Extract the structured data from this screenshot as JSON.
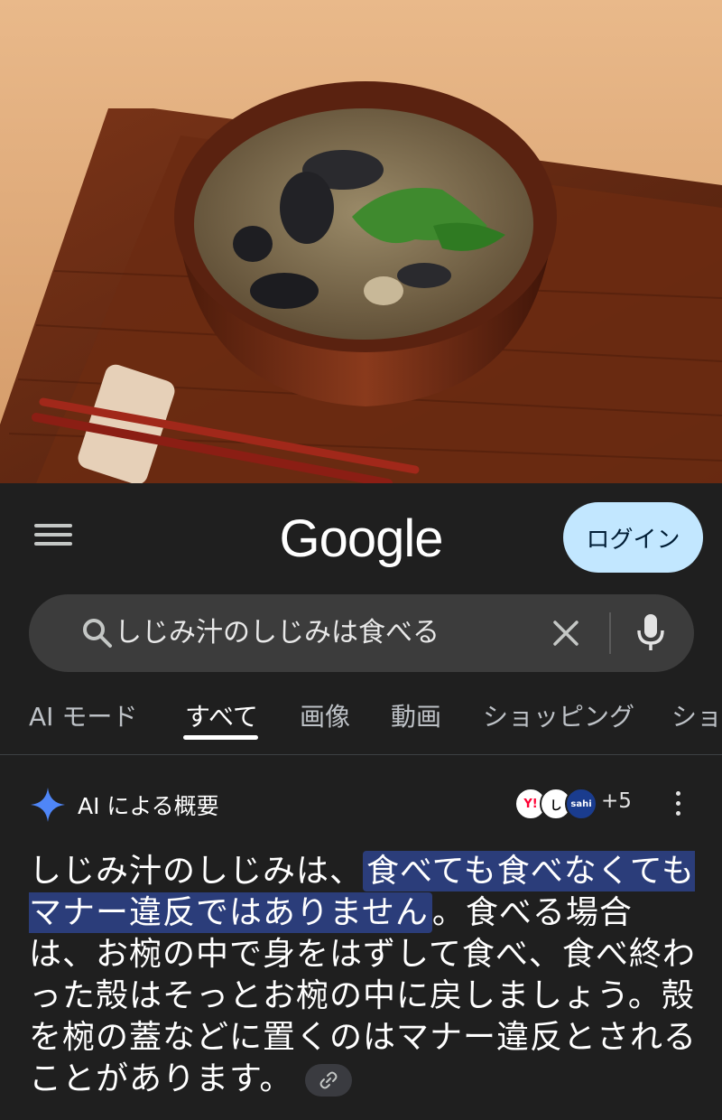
{
  "hero": {
    "image_description_icon": "miso-soup-photo"
  },
  "header": {
    "logo": "Google",
    "login_label": "ログイン"
  },
  "search": {
    "query": "しじみ汁のしじみは食べる"
  },
  "tabs": [
    {
      "label": "AI モード",
      "active": false
    },
    {
      "label": "すべて",
      "active": true
    },
    {
      "label": "画像",
      "active": false
    },
    {
      "label": "動画",
      "active": false
    },
    {
      "label": "ショッピング",
      "active": false
    },
    {
      "label": "ショ",
      "active": false
    }
  ],
  "ai_overview": {
    "title": "AI による概要",
    "sources": [
      "Y!",
      "し",
      "sahi"
    ],
    "sources_more": "+5",
    "text_before": "しじみ汁のしじみは、",
    "text_highlight": "食べても食べなくてもマナー違反ではありません",
    "text_after": "。食べる場合は、お椀の中で身をはずして食べ、食べ終わった殻はそっとお椀の中に戻しましょう。殻を椀の蓋などに置くのはマナー違反とされることがあります。"
  },
  "colors": {
    "background": "#1f1f1f",
    "search_bg": "#3c3c3c",
    "login_bg": "#c2e7ff",
    "highlight": "#2b3d7a",
    "ai_spark": "#4f86f7"
  }
}
